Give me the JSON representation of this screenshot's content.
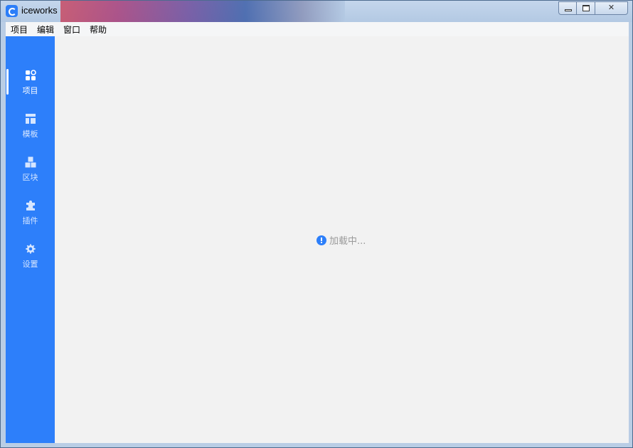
{
  "window": {
    "title": "iceworks",
    "controls": {
      "minimize": "minimize",
      "maximize": "maximize",
      "close": "✕"
    }
  },
  "menubar": {
    "items": [
      "项目",
      "编辑",
      "窗口",
      "帮助"
    ]
  },
  "sidebar": {
    "accent_color": "#2d7ffa",
    "active_index": 0,
    "items": [
      {
        "label": "项目",
        "icon": "project-grid-icon"
      },
      {
        "label": "模板",
        "icon": "template-layout-icon"
      },
      {
        "label": "区块",
        "icon": "blocks-icon"
      },
      {
        "label": "插件",
        "icon": "puzzle-icon"
      },
      {
        "label": "设置",
        "icon": "gear-icon"
      }
    ]
  },
  "main": {
    "loading_text": "加载中...",
    "loading_icon": "info-icon"
  }
}
